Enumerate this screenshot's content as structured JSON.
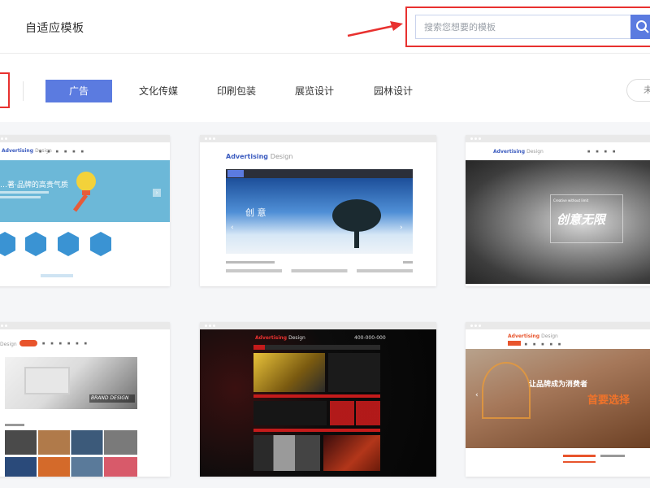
{
  "header": {
    "logo_text": "自适应模板",
    "search_placeholder": "搜索您想要的模板"
  },
  "categories": {
    "items": [
      {
        "label": "广告",
        "active": true
      },
      {
        "label": "文化传媒",
        "active": false
      },
      {
        "label": "印刷包装",
        "active": false
      },
      {
        "label": "展览设计",
        "active": false
      },
      {
        "label": "园林设计",
        "active": false
      }
    ],
    "right_pill_label": "未"
  },
  "cards": {
    "c1": {
      "logo_main": "Advertising",
      "logo_sub": "Design",
      "banner_text": "…著·品牌的高贵气质"
    },
    "c2": {
      "logo_main": "Advertising",
      "logo_sub": "Design",
      "banner_text": "创 意"
    },
    "c3": {
      "logo_main": "Advertising",
      "logo_sub": "Design",
      "banner_text": "创意无限",
      "banner_small": "Creative without limit"
    },
    "c4": {
      "logo_main": "Design",
      "brand_text": "BRAND DESIGN"
    },
    "c5": {
      "logo_main": "Advertising",
      "logo_sub": "Design",
      "phone": "400-000-000"
    },
    "c6": {
      "logo_main": "Advertising",
      "logo_sub": "Design",
      "slogan_white": "让品牌成为消费者",
      "slogan_orange": "首要选择"
    }
  },
  "colors": {
    "accent": "#5b7be0",
    "highlight_red": "#e8312f",
    "orange": "#f0732a"
  }
}
